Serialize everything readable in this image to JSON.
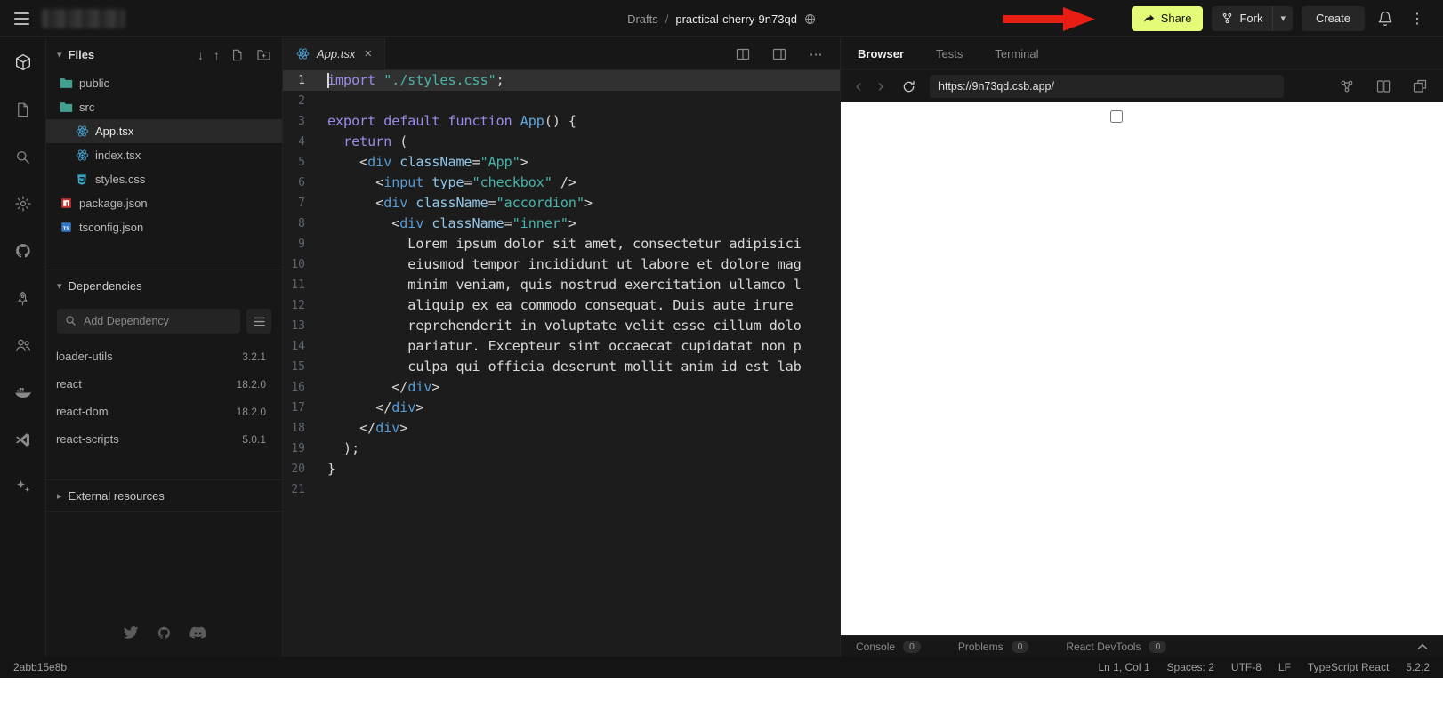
{
  "colors": {
    "accent_share": "#E4FA79",
    "annotation_red": "#E81E15"
  },
  "icons": {
    "caret_down": "▾",
    "caret_right": "▸",
    "close": "×",
    "download": "↓",
    "upload": "↑",
    "kebab_vertical": "⋮",
    "kebab_horizontal": "⋯",
    "back": "‹",
    "forward": "›"
  },
  "header": {
    "breadcrumb": {
      "folder": "Drafts",
      "separator": "/",
      "title": "practical-cherry-9n73qd"
    },
    "share_label": "Share",
    "fork_label": "Fork",
    "create_label": "Create"
  },
  "files_panel": {
    "title": "Files",
    "tree": [
      {
        "name": "public",
        "icon": "folder",
        "indent": 0
      },
      {
        "name": "src",
        "icon": "folder",
        "indent": 0
      },
      {
        "name": "App.tsx",
        "icon": "react",
        "indent": 1,
        "selected": true
      },
      {
        "name": "index.tsx",
        "icon": "react",
        "indent": 1
      },
      {
        "name": "styles.css",
        "icon": "css",
        "indent": 1
      },
      {
        "name": "package.json",
        "icon": "npm",
        "indent": 0
      },
      {
        "name": "tsconfig.json",
        "icon": "ts",
        "indent": 0
      }
    ],
    "dependencies": {
      "title": "Dependencies",
      "search_placeholder": "Add Dependency",
      "items": [
        {
          "name": "loader-utils",
          "version": "3.2.1"
        },
        {
          "name": "react",
          "version": "18.2.0"
        },
        {
          "name": "react-dom",
          "version": "18.2.0"
        },
        {
          "name": "react-scripts",
          "version": "5.0.1"
        }
      ]
    },
    "external_resources_title": "External resources"
  },
  "editor": {
    "tab_label": "App.tsx",
    "lines": [
      {
        "n": 1,
        "highlight": true,
        "cursor": true,
        "tokens": [
          {
            "t": "import",
            "c": "kw"
          },
          {
            "t": " ",
            "c": "pl"
          },
          {
            "t": "\"./styles.css\"",
            "c": "str"
          },
          {
            "t": ";",
            "c": "pl"
          }
        ]
      },
      {
        "n": 2,
        "tokens": []
      },
      {
        "n": 3,
        "tokens": [
          {
            "t": "export",
            "c": "kw"
          },
          {
            "t": " ",
            "c": "pl"
          },
          {
            "t": "default",
            "c": "kw"
          },
          {
            "t": " ",
            "c": "pl"
          },
          {
            "t": "function",
            "c": "kw"
          },
          {
            "t": " ",
            "c": "pl"
          },
          {
            "t": "App",
            "c": "fn"
          },
          {
            "t": "() {",
            "c": "pun"
          }
        ]
      },
      {
        "n": 4,
        "tokens": [
          {
            "t": "  ",
            "c": "pl"
          },
          {
            "t": "return",
            "c": "kw"
          },
          {
            "t": " (",
            "c": "pun"
          }
        ]
      },
      {
        "n": 5,
        "tokens": [
          {
            "t": "    ",
            "c": "pl"
          },
          {
            "t": "<",
            "c": "pun"
          },
          {
            "t": "div",
            "c": "tag"
          },
          {
            "t": " ",
            "c": "pl"
          },
          {
            "t": "className",
            "c": "attr"
          },
          {
            "t": "=",
            "c": "pun"
          },
          {
            "t": "\"App\"",
            "c": "str"
          },
          {
            "t": ">",
            "c": "pun"
          }
        ]
      },
      {
        "n": 6,
        "tokens": [
          {
            "t": "      ",
            "c": "pl"
          },
          {
            "t": "<",
            "c": "pun"
          },
          {
            "t": "input",
            "c": "tag"
          },
          {
            "t": " ",
            "c": "pl"
          },
          {
            "t": "type",
            "c": "attr"
          },
          {
            "t": "=",
            "c": "pun"
          },
          {
            "t": "\"checkbox\"",
            "c": "str"
          },
          {
            "t": " ",
            "c": "pl"
          },
          {
            "t": "/>",
            "c": "pun"
          }
        ]
      },
      {
        "n": 7,
        "tokens": [
          {
            "t": "      ",
            "c": "pl"
          },
          {
            "t": "<",
            "c": "pun"
          },
          {
            "t": "div",
            "c": "tag"
          },
          {
            "t": " ",
            "c": "pl"
          },
          {
            "t": "className",
            "c": "attr"
          },
          {
            "t": "=",
            "c": "pun"
          },
          {
            "t": "\"accordion\"",
            "c": "str"
          },
          {
            "t": ">",
            "c": "pun"
          }
        ]
      },
      {
        "n": 8,
        "tokens": [
          {
            "t": "        ",
            "c": "pl"
          },
          {
            "t": "<",
            "c": "pun"
          },
          {
            "t": "div",
            "c": "tag"
          },
          {
            "t": " ",
            "c": "pl"
          },
          {
            "t": "className",
            "c": "attr"
          },
          {
            "t": "=",
            "c": "pun"
          },
          {
            "t": "\"inner\"",
            "c": "str"
          },
          {
            "t": ">",
            "c": "pun"
          }
        ]
      },
      {
        "n": 9,
        "tokens": [
          {
            "t": "          Lorem ipsum dolor sit amet, consectetur adipisici",
            "c": "pl"
          }
        ]
      },
      {
        "n": 10,
        "tokens": [
          {
            "t": "          eiusmod tempor incididunt ut labore et dolore mag",
            "c": "pl"
          }
        ]
      },
      {
        "n": 11,
        "tokens": [
          {
            "t": "          minim veniam, quis nostrud exercitation ullamco l",
            "c": "pl"
          }
        ]
      },
      {
        "n": 12,
        "tokens": [
          {
            "t": "          aliquip ex ea commodo consequat. Duis aute irure",
            "c": "pl"
          }
        ]
      },
      {
        "n": 13,
        "tokens": [
          {
            "t": "          reprehenderit in voluptate velit esse cillum dolo",
            "c": "pl"
          }
        ]
      },
      {
        "n": 14,
        "tokens": [
          {
            "t": "          pariatur. Excepteur sint occaecat cupidatat non p",
            "c": "pl"
          }
        ]
      },
      {
        "n": 15,
        "tokens": [
          {
            "t": "          culpa qui officia deserunt mollit anim id est lab",
            "c": "pl"
          }
        ]
      },
      {
        "n": 16,
        "tokens": [
          {
            "t": "        ",
            "c": "pl"
          },
          {
            "t": "</",
            "c": "pun"
          },
          {
            "t": "div",
            "c": "tag"
          },
          {
            "t": ">",
            "c": "pun"
          }
        ]
      },
      {
        "n": 17,
        "tokens": [
          {
            "t": "      ",
            "c": "pl"
          },
          {
            "t": "</",
            "c": "pun"
          },
          {
            "t": "div",
            "c": "tag"
          },
          {
            "t": ">",
            "c": "pun"
          }
        ]
      },
      {
        "n": 18,
        "tokens": [
          {
            "t": "    ",
            "c": "pl"
          },
          {
            "t": "</",
            "c": "pun"
          },
          {
            "t": "div",
            "c": "tag"
          },
          {
            "t": ">",
            "c": "pun"
          }
        ]
      },
      {
        "n": 19,
        "tokens": [
          {
            "t": "  );",
            "c": "pl"
          }
        ]
      },
      {
        "n": 20,
        "tokens": [
          {
            "t": "}",
            "c": "pl"
          }
        ]
      },
      {
        "n": 21,
        "tokens": []
      }
    ]
  },
  "preview": {
    "tabs": [
      {
        "label": "Browser",
        "active": true
      },
      {
        "label": "Tests",
        "active": false
      },
      {
        "label": "Terminal",
        "active": false
      }
    ],
    "url": "https://9n73qd.csb.app/",
    "console_bar": [
      {
        "label": "Console",
        "count": "0"
      },
      {
        "label": "Problems",
        "count": "0"
      },
      {
        "label": "React DevTools",
        "count": "0"
      }
    ]
  },
  "status_bar": {
    "left_id": "2abb15e8b",
    "items": [
      "Ln 1, Col 1",
      "Spaces: 2",
      "UTF-8",
      "LF",
      "TypeScript React",
      "5.2.2"
    ]
  }
}
